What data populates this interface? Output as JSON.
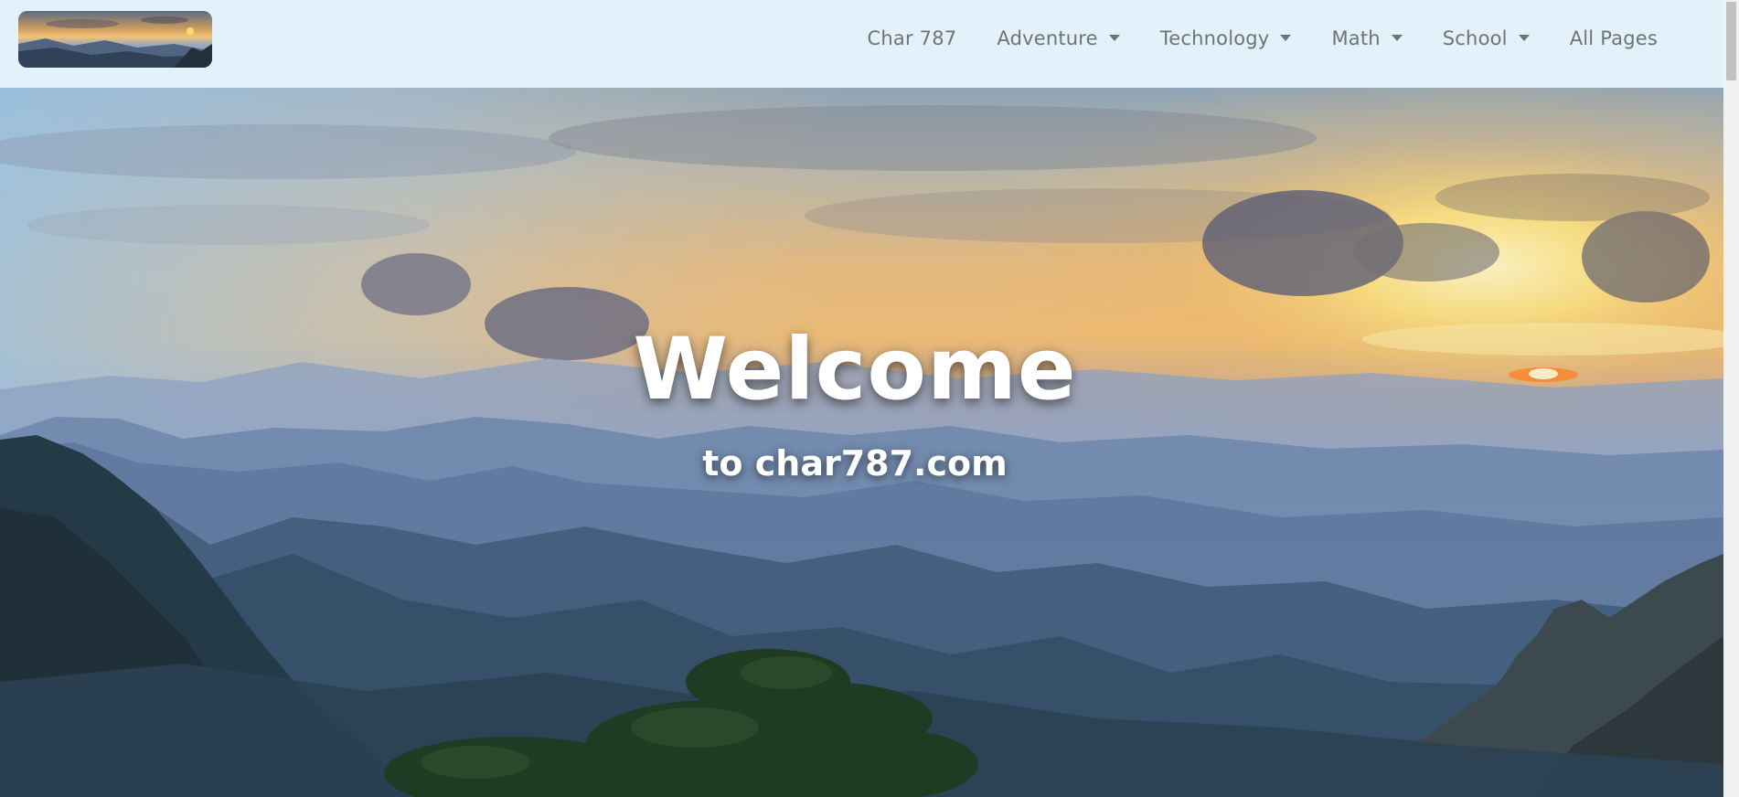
{
  "brand": {
    "logo": "mountain-sunset-logo"
  },
  "nav": {
    "items": [
      {
        "label": "Char 787",
        "dropdown": false
      },
      {
        "label": "Adventure",
        "dropdown": true
      },
      {
        "label": "Technology",
        "dropdown": true
      },
      {
        "label": "Math",
        "dropdown": true
      },
      {
        "label": "School",
        "dropdown": true
      },
      {
        "label": "All Pages",
        "dropdown": false
      }
    ]
  },
  "hero": {
    "title": "Welcome",
    "subtitle": "to char787.com",
    "background": "mountain-sunset-landscape"
  },
  "colors": {
    "navbar_bg": "#e3f1fb",
    "nav_text": "#6f7378",
    "hero_text": "#ffffff"
  }
}
